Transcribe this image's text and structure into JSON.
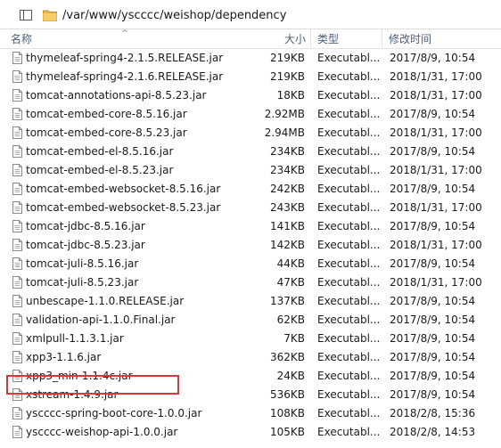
{
  "address_bar": {
    "path": "/var/www/yscccc/weishop/dependency"
  },
  "columns": {
    "name": "名称",
    "size": "大小",
    "type": "类型",
    "modified": "修改时间"
  },
  "files": [
    {
      "name": "thymeleaf-spring4-2.1.5.RELEASE.jar",
      "size": "219KB",
      "type": "Executabl...",
      "modified": "2017/8/9, 10:54"
    },
    {
      "name": "thymeleaf-spring4-2.1.6.RELEASE.jar",
      "size": "219KB",
      "type": "Executabl...",
      "modified": "2018/1/31, 17:00"
    },
    {
      "name": "tomcat-annotations-api-8.5.23.jar",
      "size": "18KB",
      "type": "Executabl...",
      "modified": "2018/1/31, 17:00"
    },
    {
      "name": "tomcat-embed-core-8.5.16.jar",
      "size": "2.92MB",
      "type": "Executabl...",
      "modified": "2017/8/9, 10:54"
    },
    {
      "name": "tomcat-embed-core-8.5.23.jar",
      "size": "2.94MB",
      "type": "Executabl...",
      "modified": "2018/1/31, 17:00"
    },
    {
      "name": "tomcat-embed-el-8.5.16.jar",
      "size": "234KB",
      "type": "Executabl...",
      "modified": "2017/8/9, 10:54"
    },
    {
      "name": "tomcat-embed-el-8.5.23.jar",
      "size": "234KB",
      "type": "Executabl...",
      "modified": "2018/1/31, 17:00"
    },
    {
      "name": "tomcat-embed-websocket-8.5.16.jar",
      "size": "242KB",
      "type": "Executabl...",
      "modified": "2017/8/9, 10:54"
    },
    {
      "name": "tomcat-embed-websocket-8.5.23.jar",
      "size": "243KB",
      "type": "Executabl...",
      "modified": "2018/1/31, 17:00"
    },
    {
      "name": "tomcat-jdbc-8.5.16.jar",
      "size": "141KB",
      "type": "Executabl...",
      "modified": "2017/8/9, 10:54"
    },
    {
      "name": "tomcat-jdbc-8.5.23.jar",
      "size": "142KB",
      "type": "Executabl...",
      "modified": "2018/1/31, 17:00"
    },
    {
      "name": "tomcat-juli-8.5.16.jar",
      "size": "44KB",
      "type": "Executabl...",
      "modified": "2017/8/9, 10:54"
    },
    {
      "name": "tomcat-juli-8.5.23.jar",
      "size": "47KB",
      "type": "Executabl...",
      "modified": "2018/1/31, 17:00"
    },
    {
      "name": "unbescape-1.1.0.RELEASE.jar",
      "size": "137KB",
      "type": "Executabl...",
      "modified": "2017/8/9, 10:54"
    },
    {
      "name": "validation-api-1.1.0.Final.jar",
      "size": "62KB",
      "type": "Executabl...",
      "modified": "2017/8/9, 10:54"
    },
    {
      "name": "xmlpull-1.1.3.1.jar",
      "size": "7KB",
      "type": "Executabl...",
      "modified": "2017/8/9, 10:54"
    },
    {
      "name": "xpp3-1.1.6.jar",
      "size": "362KB",
      "type": "Executabl...",
      "modified": "2017/8/9, 10:54"
    },
    {
      "name": "xpp3_min-1.1.4c.jar",
      "size": "24KB",
      "type": "Executabl...",
      "modified": "2017/8/9, 10:54"
    },
    {
      "name": "xstream-1.4.9.jar",
      "size": "536KB",
      "type": "Executabl...",
      "modified": "2017/8/9, 10:54"
    },
    {
      "name": "yscccc-spring-boot-core-1.0.0.jar",
      "size": "108KB",
      "type": "Executabl...",
      "modified": "2018/2/8, 15:36"
    },
    {
      "name": "yscccc-weishop-api-1.0.0.jar",
      "size": "105KB",
      "type": "Executabl...",
      "modified": "2018/2/8, 14:53"
    }
  ],
  "colors": {
    "highlight_border": "#d9383a",
    "header_text": "#4c607a",
    "folder": "#e8b845"
  }
}
